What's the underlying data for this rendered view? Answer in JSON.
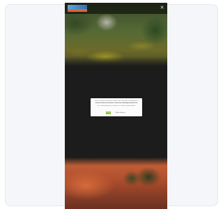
{
  "brand": {
    "colors": {
      "frame_bg": "#f4f6f9",
      "dark_bg": "#1c1c1c",
      "accept_green": "#8dc63f",
      "logo_blue": "#2f6fb5",
      "logo_orange": "#e0633a"
    }
  },
  "header": {
    "menu_icon": "menu-icon"
  },
  "hero": {
    "alt": ""
  },
  "cookie_dialog": {
    "line1": "Diese Website verwendet Cookies, um Ihnen den bestmöglichen",
    "line2": "Service bieten zu können. Durch die Nutzung stimmen Sie",
    "line3": "der Verwendung von Cookies zu. Weitere Informationen",
    "accept_label": "OK",
    "more_label": "Mehr erfahren"
  }
}
